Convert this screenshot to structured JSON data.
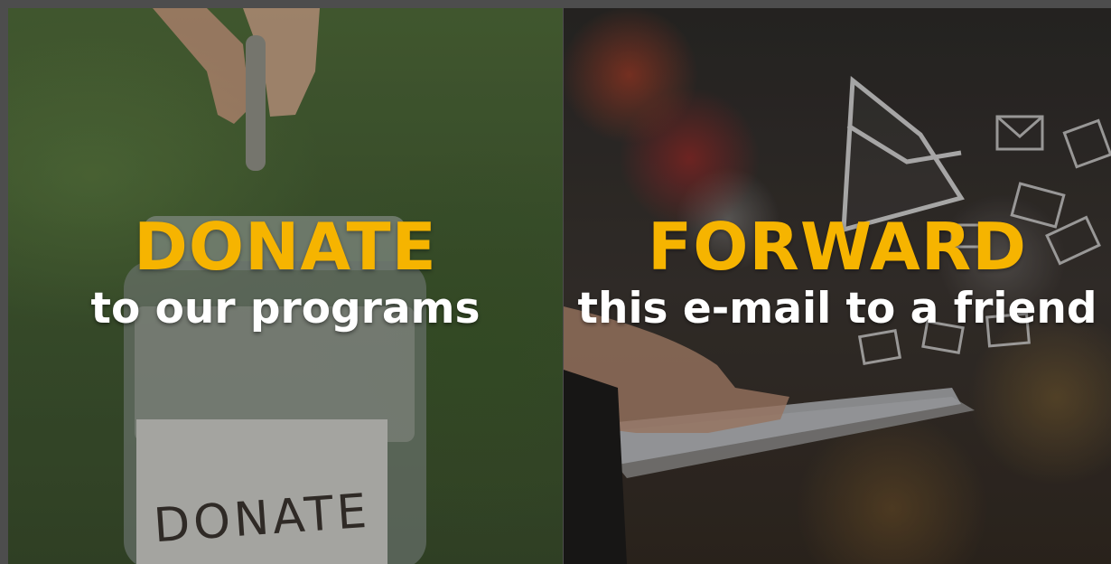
{
  "donate_panel": {
    "headline": "DONATE",
    "subtext": "to our programs",
    "jar_label": "DONATE"
  },
  "forward_panel": {
    "headline": "FORWARD",
    "subtext": "this e-mail to a friend"
  },
  "colors": {
    "headline": "#f6b400",
    "subtext": "#ffffff",
    "frame": "#4d4d4d"
  }
}
